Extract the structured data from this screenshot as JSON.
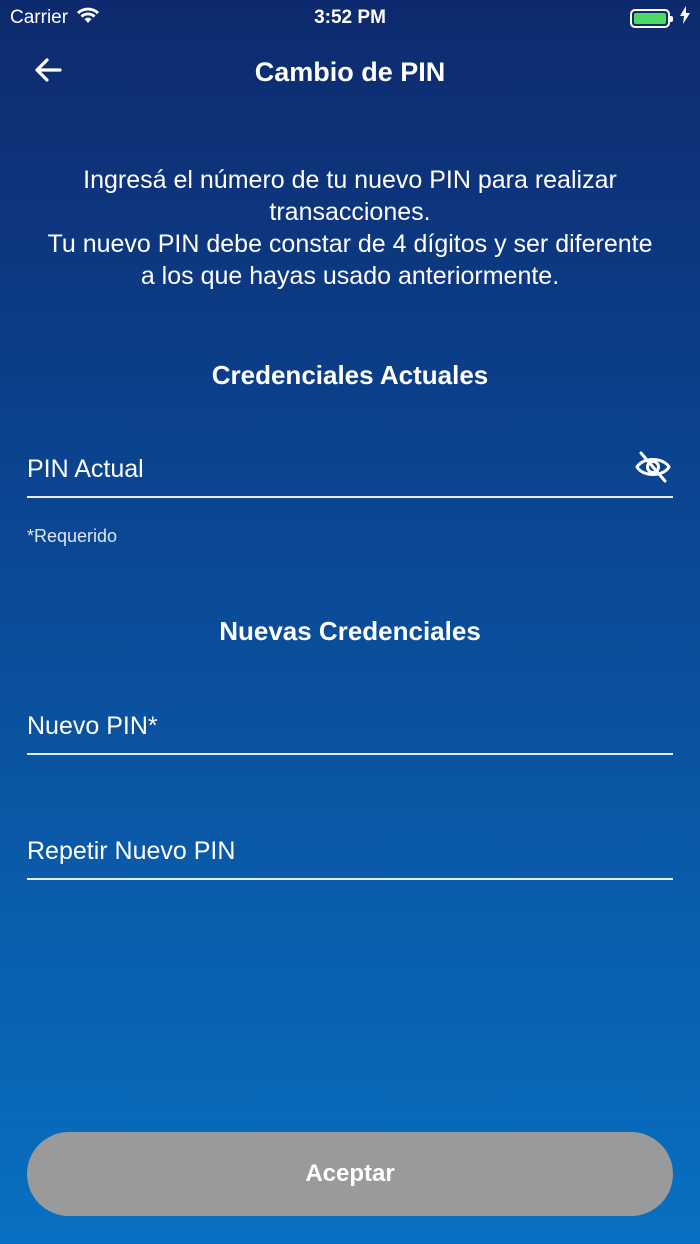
{
  "status_bar": {
    "carrier": "Carrier",
    "time": "3:52 PM"
  },
  "nav": {
    "title": "Cambio de PIN"
  },
  "intro": {
    "line1": "Ingresá el número de tu nuevo PIN para realizar transacciones.",
    "line2": "Tu nuevo PIN debe constar de 4 dígitos y ser diferente a los que hayas usado anteriormente."
  },
  "current_section": {
    "heading": "Credenciales Actuales",
    "pin_label": "PIN Actual",
    "required_hint": "*Requerido"
  },
  "new_section": {
    "heading": "Nuevas Credenciales",
    "new_pin_label": "Nuevo PIN*",
    "repeat_pin_label": "Repetir Nuevo PIN"
  },
  "actions": {
    "accept_label": "Aceptar"
  },
  "colors": {
    "gradient_top": "#0e2a6e",
    "gradient_bottom": "#0870c2",
    "button_disabled": "#9a9a9a",
    "battery": "#4cd964"
  },
  "icons": {
    "back": "arrow-left-icon",
    "visibility": "eye-slash-icon",
    "wifi": "wifi-icon",
    "battery": "battery-icon",
    "charging": "bolt-icon"
  }
}
